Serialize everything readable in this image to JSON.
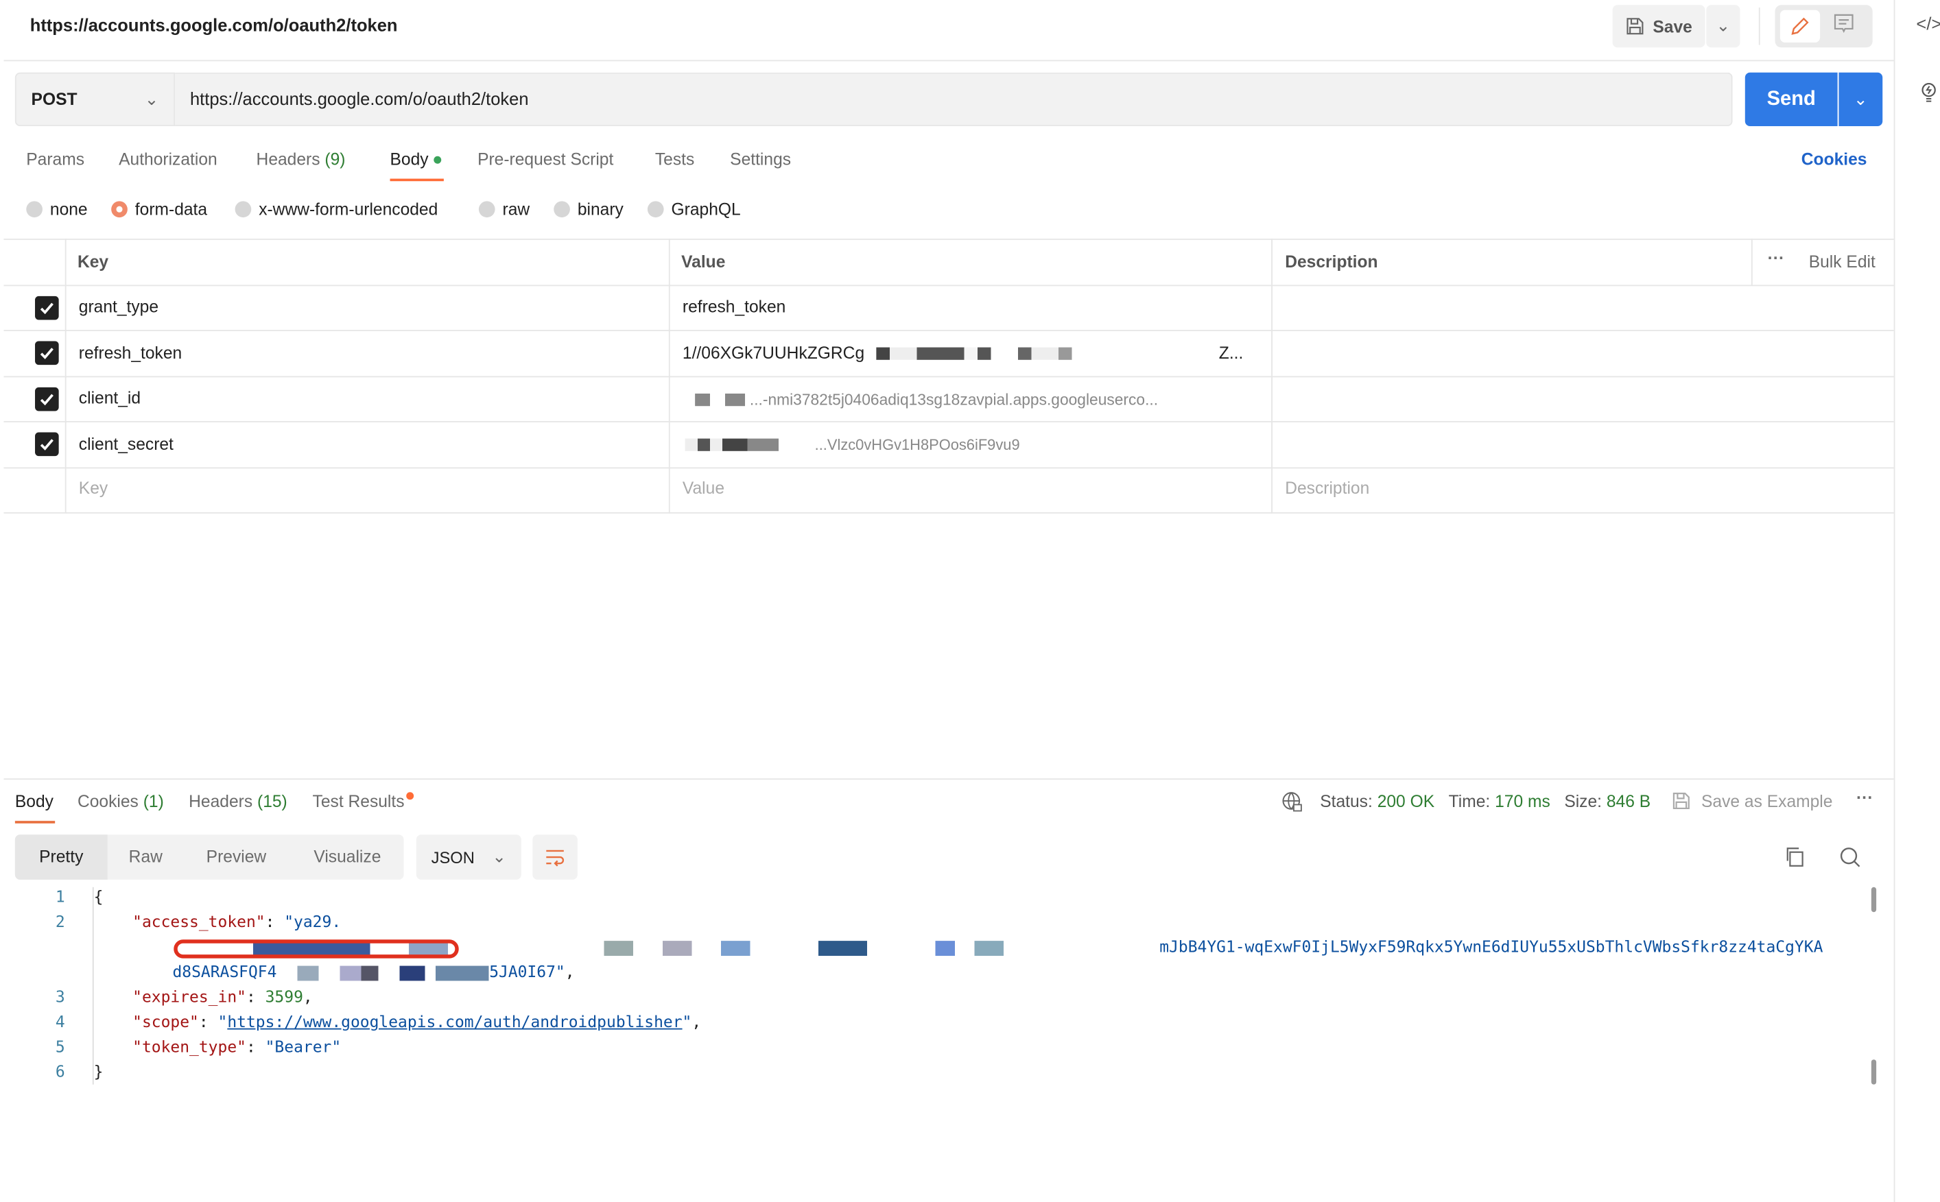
{
  "header": {
    "title": "https://accounts.google.com/o/oauth2/token",
    "save_label": "Save"
  },
  "request": {
    "method": "POST",
    "url": "https://accounts.google.com/o/oauth2/token",
    "send_label": "Send"
  },
  "tabs": [
    {
      "label": "Params"
    },
    {
      "label": "Authorization"
    },
    {
      "label": "Headers",
      "count": "(9)"
    },
    {
      "label": "Body",
      "active": true
    },
    {
      "label": "Pre-request Script"
    },
    {
      "label": "Tests"
    },
    {
      "label": "Settings"
    }
  ],
  "cookies_label": "Cookies",
  "body_types": [
    {
      "label": "none"
    },
    {
      "label": "form-data",
      "selected": true
    },
    {
      "label": "x-www-form-urlencoded"
    },
    {
      "label": "raw"
    },
    {
      "label": "binary"
    },
    {
      "label": "GraphQL"
    }
  ],
  "table": {
    "headers": {
      "key": "Key",
      "value": "Value",
      "description": "Description",
      "bulk_edit": "Bulk Edit"
    },
    "rows": [
      {
        "key": "grant_type",
        "value": "refresh_token",
        "checked": true
      },
      {
        "key": "refresh_token",
        "value": "1//06XGk7UUHkZGRCg",
        "value_tail": "Z...",
        "checked": true
      },
      {
        "key": "client_id",
        "value": "...-nmi3782t5j0406adiq13sg18zavpial.apps.googleuserco...",
        "checked": true
      },
      {
        "key": "client_secret",
        "value": "...Vlzc0vHGv1H8POos6iF9vu9",
        "checked": true
      }
    ],
    "placeholders": {
      "key": "Key",
      "value": "Value",
      "description": "Description"
    }
  },
  "response": {
    "tabs": [
      {
        "label": "Body",
        "active": true
      },
      {
        "label": "Cookies",
        "count": "(1)"
      },
      {
        "label": "Headers",
        "count": "(15)"
      },
      {
        "label": "Test Results"
      }
    ],
    "status_label": "Status:",
    "status": "200 OK",
    "time_label": "Time:",
    "time": "170 ms",
    "size_label": "Size:",
    "size": "846 B",
    "save_example": "Save as Example",
    "views": [
      "Pretty",
      "Raw",
      "Preview",
      "Visualize"
    ],
    "format": "JSON",
    "code": {
      "access_token_key": "\"access_token\"",
      "access_token_start": "\"ya29.",
      "access_token_mid": "mJbB4YG1-wqExwF0IjL5WyxF59Rqkx5YwnE6dIUYu55xUSbThlcVWbsSfkr8zz4taCgYKA",
      "access_token_line3_start": "d8SARASFQF4",
      "access_token_end": "5JA0I67\"",
      "expires_key": "\"expires_in\"",
      "expires_val": "3599",
      "scope_key": "\"scope\"",
      "scope_val": "https://www.googleapis.com/auth/androidpublisher",
      "token_type_key": "\"token_type\"",
      "token_type_val": "\"Bearer\""
    }
  },
  "colors": {
    "accent": "#ff6c37",
    "send": "#2f7ae5",
    "link": "#1f63c9",
    "status_ok": "#2e7d32",
    "annotation": "#e0301e"
  }
}
